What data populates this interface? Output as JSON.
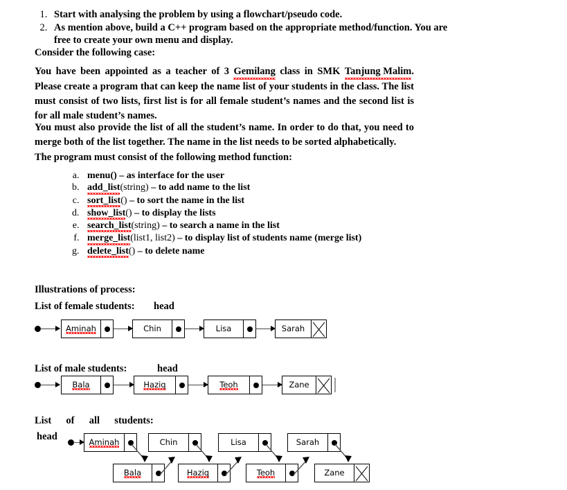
{
  "document": {
    "instructions": [
      "Start with analysing the problem by using a flowchart/pseudo code.",
      "As mention above, build a C++ program based on the appropriate method/function. You are free to create your own menu and display."
    ],
    "consider_heading": "Consider the following case:",
    "case_paragraph_parts": {
      "p1": "You have been appointed as a teacher of 3 ",
      "misspelled1": "Gemilang",
      "p2": " class in SMK ",
      "misspelled2": "Tanjung Malim",
      "p3": ". Please create a program that can keep the name list of your students in the class. The list must consist of two lists, first list is for all female student’s names and the second list is for all male student’s names."
    },
    "merge_paragraph": "You must also provide the list of all the student’s name. In order to do that, you need to merge both of the list together. The name in the list needs to be sorted alphabetically.",
    "methods_heading": "The program must consist of the following method function:",
    "methods": [
      {
        "name": "menu()",
        "misspelled": "",
        "signature": "",
        "desc": " – as interface for the user"
      },
      {
        "name": "",
        "misspelled": "add_list",
        "signature": "(string)",
        "desc": " – to add name to the list"
      },
      {
        "name": "",
        "misspelled": "sort_list",
        "signature": "()",
        "desc": " – to sort the name in the list"
      },
      {
        "name": "",
        "misspelled": "show_list",
        "signature": "()",
        "desc": " – to display the lists"
      },
      {
        "name": "",
        "misspelled": "search_list",
        "signature": "(string)",
        "desc": " – to search a name in the list"
      },
      {
        "name": "",
        "misspelled": "merge_list",
        "signature": "(list1, list2)",
        "desc": " – to display list of students name (merge list)"
      },
      {
        "name": "",
        "misspelled": "delete_list",
        "signature": "()",
        "desc": " – to delete name"
      }
    ],
    "illustrations_heading": "Illustrations of process:"
  },
  "diagrams": {
    "female": {
      "label": "List of female students:",
      "head_label": "head",
      "nodes": [
        {
          "value": "Aminah",
          "misspelled": true,
          "null_pointer": false
        },
        {
          "value": "Chin",
          "misspelled": false,
          "null_pointer": false
        },
        {
          "value": "Lisa",
          "misspelled": false,
          "null_pointer": false
        },
        {
          "value": "Sarah",
          "misspelled": false,
          "null_pointer": true
        }
      ]
    },
    "male": {
      "label": "List of male students:",
      "head_label": "head",
      "nodes": [
        {
          "value": "Bala",
          "misspelled": true,
          "null_pointer": false
        },
        {
          "value": "Haziq",
          "misspelled": true,
          "null_pointer": false
        },
        {
          "value": "Teoh",
          "misspelled": true,
          "null_pointer": false
        },
        {
          "value": "Zane",
          "misspelled": false,
          "null_pointer": true
        }
      ]
    },
    "all": {
      "label": "List  of  all  students:",
      "head_label": "head",
      "top_nodes": [
        {
          "value": "Aminah",
          "misspelled": true,
          "null_pointer": false
        },
        {
          "value": "Chin",
          "misspelled": false,
          "null_pointer": false
        },
        {
          "value": "Lisa",
          "misspelled": false,
          "null_pointer": false
        },
        {
          "value": "Sarah",
          "misspelled": false,
          "null_pointer": false
        }
      ],
      "bottom_nodes": [
        {
          "value": "Bala",
          "misspelled": true,
          "null_pointer": false
        },
        {
          "value": "Haziq",
          "misspelled": true,
          "null_pointer": false
        },
        {
          "value": "Teoh",
          "misspelled": true,
          "null_pointer": false
        },
        {
          "value": "Zane",
          "misspelled": false,
          "null_pointer": true
        }
      ]
    }
  },
  "colors": {
    "spellcheck_red": "#ff0000",
    "text": "#000000",
    "arrow": "#555555",
    "background": "#ffffff",
    "caret": "#9a9a9a"
  }
}
